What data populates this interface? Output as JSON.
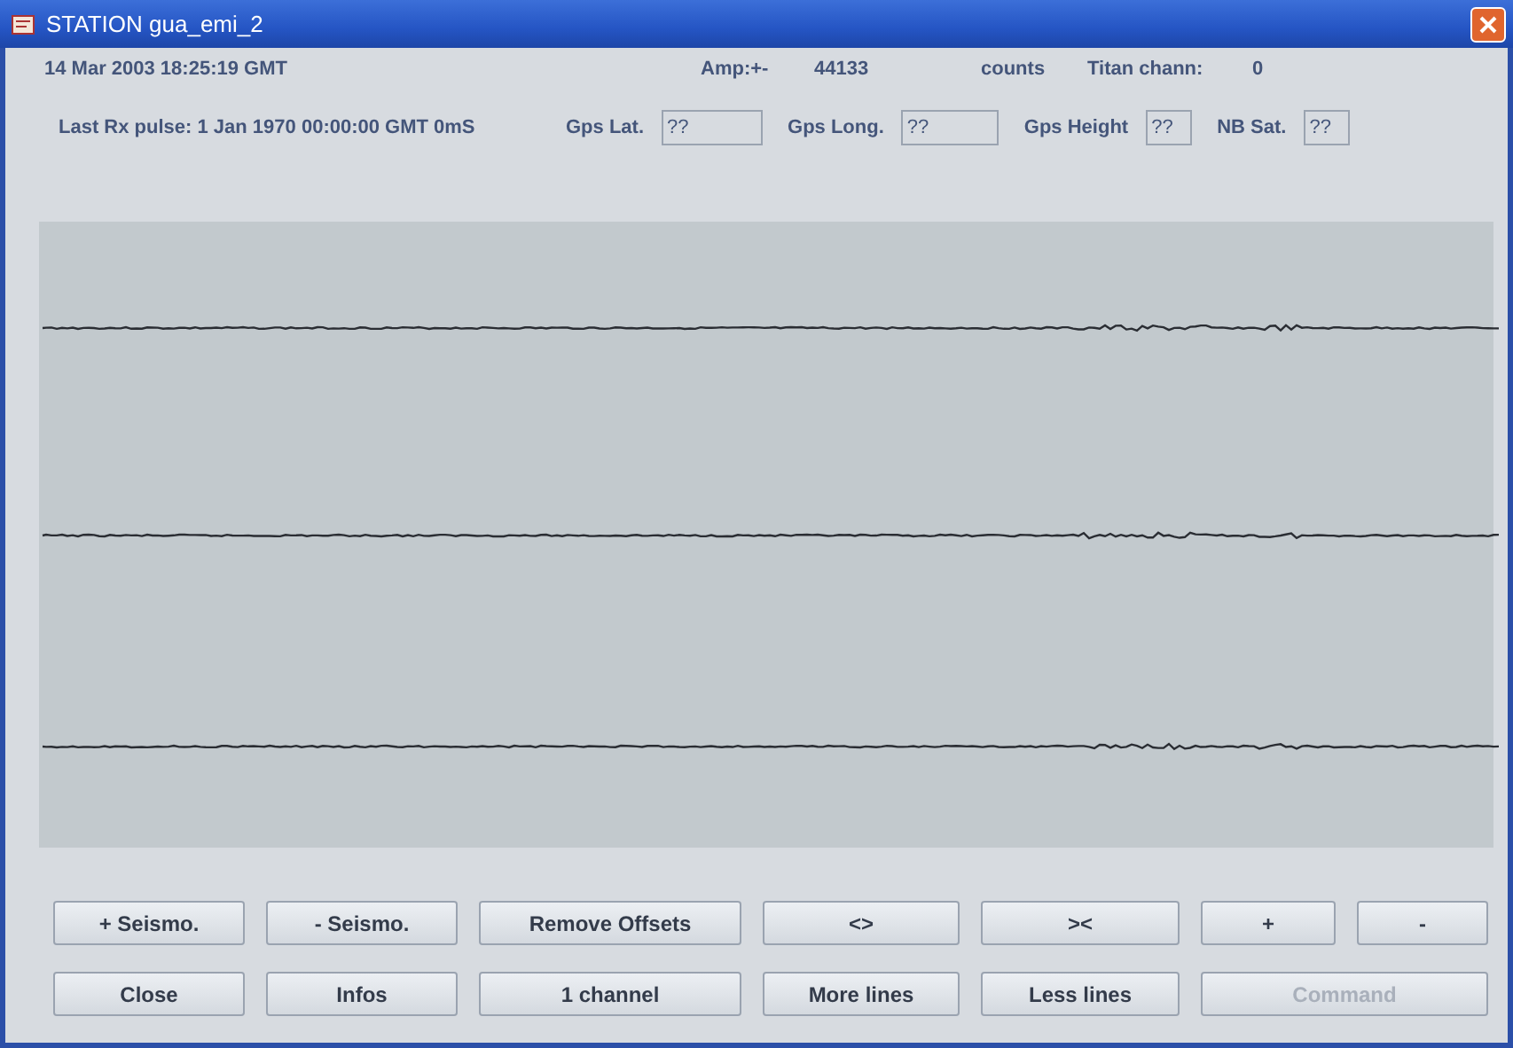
{
  "window": {
    "title": "STATION gua_emi_2"
  },
  "info_row": {
    "date": "14 Mar 2003 18:25:19 GMT",
    "amp_label": "Amp:+-",
    "amp_value": "44133",
    "amp_unit": "counts",
    "titan_label": "Titan chann:",
    "titan_value": "0"
  },
  "gps_row": {
    "last_pulse": "Last Rx pulse: 1 Jan 1970 00:00:00 GMT 0mS",
    "fields": [
      {
        "label": "Gps Lat.",
        "value": "??"
      },
      {
        "label": "Gps Long.",
        "value": "??"
      },
      {
        "label": "Gps Height",
        "value": "??"
      },
      {
        "label": "NB Sat.",
        "value": "??"
      }
    ]
  },
  "button_rows": [
    [
      {
        "label": "+ Seismo.",
        "disabled": false
      },
      {
        "label": "- Seismo.",
        "disabled": false
      },
      {
        "label": "Remove Offsets",
        "disabled": false
      },
      {
        "label": "<>",
        "disabled": false
      },
      {
        "label": "><",
        "disabled": false
      },
      {
        "label": "+",
        "disabled": false
      },
      {
        "label": "-",
        "disabled": false
      }
    ],
    [
      {
        "label": "Close",
        "disabled": false
      },
      {
        "label": "Infos",
        "disabled": false
      },
      {
        "label": "1 channel",
        "disabled": false
      },
      {
        "label": "More lines",
        "disabled": false
      },
      {
        "label": "Less lines",
        "disabled": false
      },
      {
        "label": "Command",
        "disabled": true
      }
    ]
  ]
}
